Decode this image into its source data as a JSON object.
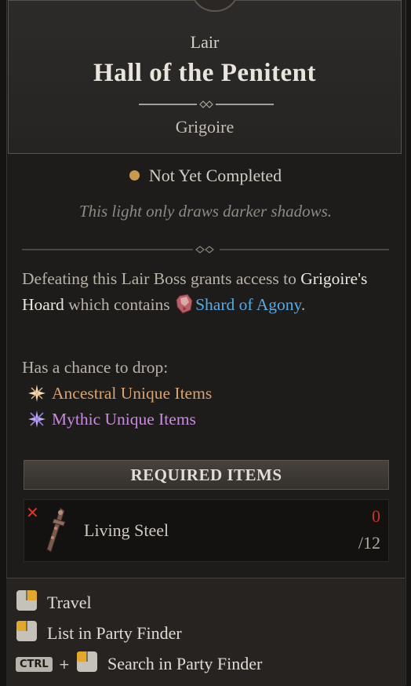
{
  "header": {
    "type": "Lair",
    "title": "Hall of the Penitent",
    "subtitle": "Grigoire"
  },
  "status": {
    "text": "Not Yet Completed",
    "dot_color": "#c99a4e"
  },
  "flavor": "This light only draws darker shadows.",
  "description": {
    "part1": "Defeating this Lair Boss grants access to ",
    "hoard": "Grigoire's Hoard",
    "part2": " which contains ",
    "shard_icon": "shard-of-agony-icon",
    "shard": "Shard of Agony",
    "part3": "."
  },
  "drops": {
    "label": "Has a chance to drop:",
    "items": [
      {
        "label": "Ancestral Unique Items",
        "icon": "ancestral-star-icon",
        "color": "#d9a36f"
      },
      {
        "label": "Mythic Unique Items",
        "icon": "mythic-star-icon",
        "color": "#c98be0"
      }
    ]
  },
  "required": {
    "heading": "REQUIRED ITEMS",
    "items": [
      {
        "name": "Living Steel",
        "have": "0",
        "need": "/12",
        "icon": "living-steel-icon",
        "missing_icon": "x-mark-icon"
      }
    ]
  },
  "actions": [
    {
      "label": "Travel",
      "icon": "mouse-right-click-icon"
    },
    {
      "label": "List in Party Finder",
      "icon": "mouse-left-click-icon"
    },
    {
      "key": "CTRL",
      "plus": "+",
      "label": "Search in Party Finder",
      "icon": "mouse-left-click-icon"
    }
  ],
  "colors": {
    "accent_blue": "#58a9e2",
    "missing_red": "#c5352a"
  }
}
